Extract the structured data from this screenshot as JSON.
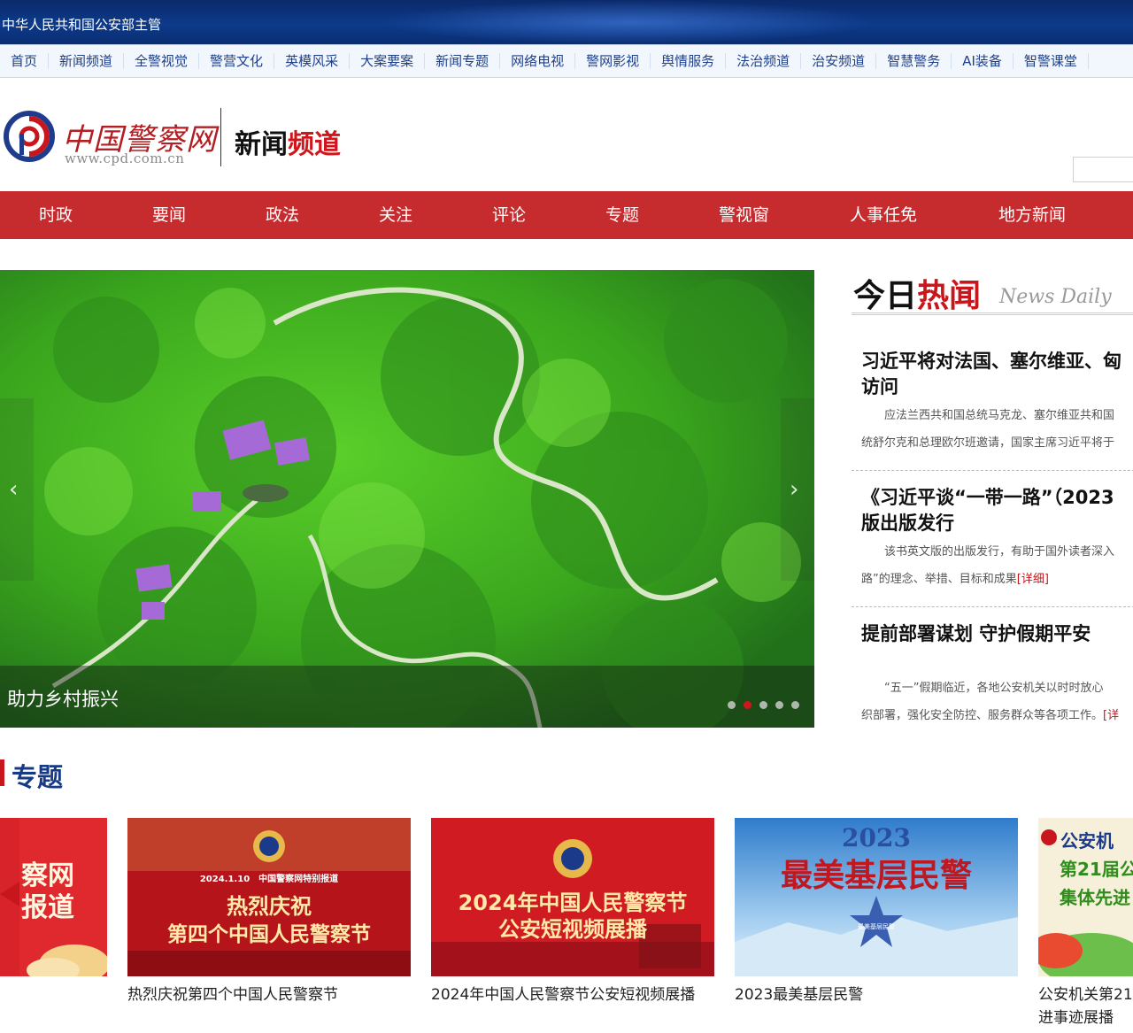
{
  "header": {
    "supervisor": "中华人民共和国公安部主管"
  },
  "subnav": [
    "首页",
    "新闻频道",
    "全警视觉",
    "警营文化",
    "英模风采",
    "大案要案",
    "新闻专题",
    "网络电视",
    "警网影视",
    "舆情服务",
    "法治频道",
    "治安频道",
    "智慧警务",
    "AI装备",
    "智警课堂"
  ],
  "brand": {
    "logo_text": "中国警察网",
    "logo_url": "www.cpd.com.cn",
    "channel_black": "新闻",
    "channel_red": "频道"
  },
  "mainnav": [
    "时政",
    "要闻",
    "政法",
    "关注",
    "评论",
    "专题",
    "警视窗",
    "人事任免",
    "地方新闻"
  ],
  "carousel": {
    "caption": "助力乡村振兴",
    "prev_icon": "‹",
    "next_icon": "›",
    "active_dot": 2,
    "dot_count": 5
  },
  "hot": {
    "title_black": "今日",
    "title_red": "热闻",
    "subtitle": "News Daily",
    "items": [
      {
        "headline_1": "习近平将对法国、塞尔维亚、匈",
        "headline_2": "访问",
        "body_1": "　　应法兰西共和国总统马克龙、塞尔维亚共和国",
        "body_2": "统舒尔克和总理欧尔班邀请，国家主席习近平将于",
        "more": ""
      },
      {
        "headline_1": "《习近平谈“一带一路”（2023",
        "headline_2": "版出版发行",
        "body_1": "　　该书英文版的出版发行，有助于国外读者深入",
        "body_2": "路”的理念、举措、目标和成果",
        "more": "[详细]"
      },
      {
        "headline_1": "提前部署谋划 守护假期平安",
        "headline_2": "",
        "body_1": "　　“五一”假期临近，各地公安机关以时时放心",
        "body_2": "织部署，强化安全防控、服务群众等各项工作。",
        "more": "[详"
      }
    ]
  },
  "topics": {
    "label": "专题",
    "partial_left_text_1": "察网",
    "partial_left_text_2": "报道",
    "cards": [
      {
        "caption": "热烈庆祝第四个中国人民警察节",
        "date_line": "2024.1.10　中国警察网特别报道",
        "art_1": "热烈庆祝",
        "art_2": "第四个中国人民警察节"
      },
      {
        "caption": "2024年中国人民警察节公安短视频展播",
        "art_1": "2024年中国人民警察节",
        "art_2": "公安短视频展播"
      },
      {
        "caption": "2023最美基层民警",
        "art_1": "2023",
        "art_2": "最美基层民警",
        "badge": "最美基层民警"
      },
      {
        "caption_1": "公安机关第21",
        "caption_2": "进事迹展播",
        "art_1": "公安机",
        "art_2": "第21届公",
        "art_3": "集体先进"
      }
    ]
  },
  "colors": {
    "brand_red": "#c62b2e",
    "nav_blue": "#0d3a8a",
    "topic_title_blue": "#173a87",
    "accent_red": "#d0161c"
  }
}
